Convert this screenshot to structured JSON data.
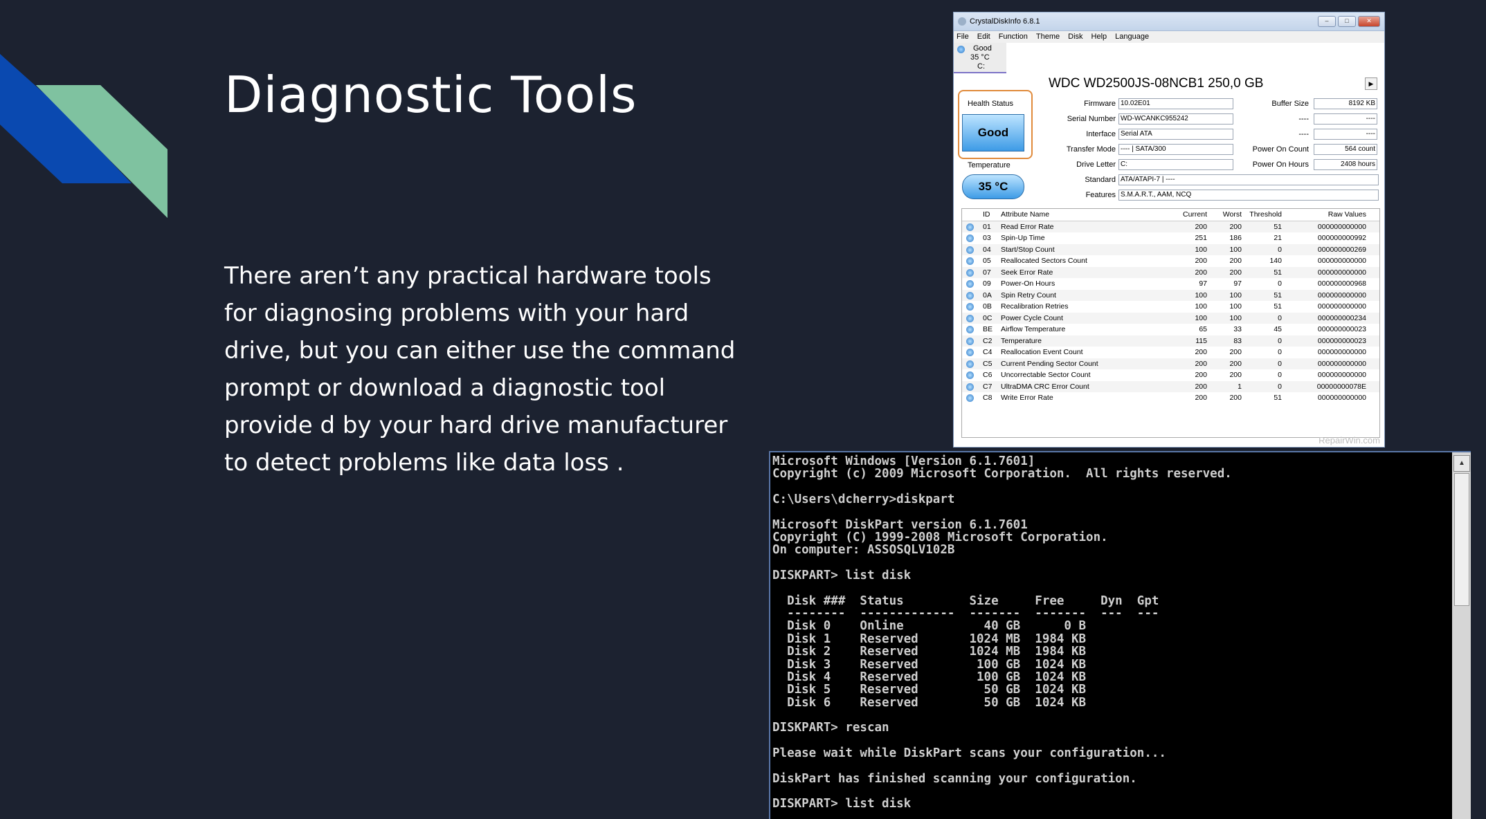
{
  "slide": {
    "title": "Diagnostic Tools",
    "body": "There aren’t any practical hardware tools for diagnosing problems with your hard drive, but you can either use the command prompt or download a diagnostic tool provide d by your hard drive manufacturer to detect problems like data loss .",
    "colors": {
      "background": "#1c2230",
      "deco_blue": "#0a49b0",
      "deco_green": "#7fc2a0"
    }
  },
  "crystaldiskinfo": {
    "window_title": "CrystalDiskInfo 6.8.1",
    "menu": [
      "File",
      "Edit",
      "Function",
      "Theme",
      "Disk",
      "Help",
      "Language"
    ],
    "disk_tab": {
      "status": "Good",
      "temp": "35 °C",
      "drive": "C:"
    },
    "model": "WDC WD2500JS-08NCB1 250,0 GB",
    "health_status_label": "Health Status",
    "health_status": "Good",
    "temperature_label": "Temperature",
    "temperature": "35 °C",
    "fields": {
      "firmware_label": "Firmware",
      "firmware": "10.02E01",
      "serial_label": "Serial Number",
      "serial": "WD-WCANKC955242",
      "interface_label": "Interface",
      "interface": "Serial ATA",
      "transfer_label": "Transfer Mode",
      "transfer": "---- | SATA/300",
      "drive_letter_label": "Drive Letter",
      "drive_letter": "C:",
      "standard_label": "Standard",
      "standard": "ATA/ATAPI-7 | ----",
      "features_label": "Features",
      "features": "S.M.A.R.T., AAM, NCQ",
      "buffer_label": "Buffer Size",
      "buffer": "8192 KB",
      "blank1_label": "----",
      "blank1": "----",
      "blank2_label": "----",
      "blank2": "----",
      "power_count_label": "Power On Count",
      "power_count": "564 count",
      "power_hours_label": "Power On Hours",
      "power_hours": "2408 hours"
    },
    "attr_headers": {
      "id": "ID",
      "name": "Attribute Name",
      "current": "Current",
      "worst": "Worst",
      "threshold": "Threshold",
      "raw": "Raw Values"
    },
    "attributes": [
      [
        "01",
        "Read Error Rate",
        "200",
        "200",
        "51",
        "000000000000"
      ],
      [
        "03",
        "Spin-Up Time",
        "251",
        "186",
        "21",
        "000000000992"
      ],
      [
        "04",
        "Start/Stop Count",
        "100",
        "100",
        "0",
        "000000000269"
      ],
      [
        "05",
        "Reallocated Sectors Count",
        "200",
        "200",
        "140",
        "000000000000"
      ],
      [
        "07",
        "Seek Error Rate",
        "200",
        "200",
        "51",
        "000000000000"
      ],
      [
        "09",
        "Power-On Hours",
        "97",
        "97",
        "0",
        "000000000968"
      ],
      [
        "0A",
        "Spin Retry Count",
        "100",
        "100",
        "51",
        "000000000000"
      ],
      [
        "0B",
        "Recalibration Retries",
        "100",
        "100",
        "51",
        "000000000000"
      ],
      [
        "0C",
        "Power Cycle Count",
        "100",
        "100",
        "0",
        "000000000234"
      ],
      [
        "BE",
        "Airflow Temperature",
        "65",
        "33",
        "45",
        "000000000023"
      ],
      [
        "C2",
        "Temperature",
        "115",
        "83",
        "0",
        "000000000023"
      ],
      [
        "C4",
        "Reallocation Event Count",
        "200",
        "200",
        "0",
        "000000000000"
      ],
      [
        "C5",
        "Current Pending Sector Count",
        "200",
        "200",
        "0",
        "000000000000"
      ],
      [
        "C6",
        "Uncorrectable Sector Count",
        "200",
        "200",
        "0",
        "000000000000"
      ],
      [
        "C7",
        "UltraDMA CRC Error Count",
        "200",
        "1",
        "0",
        "00000000078E"
      ],
      [
        "C8",
        "Write Error Rate",
        "200",
        "200",
        "51",
        "000000000000"
      ]
    ],
    "watermark": "RepairWin.com"
  },
  "cmd": {
    "lines": [
      "Microsoft Windows [Version 6.1.7601]",
      "Copyright (c) 2009 Microsoft Corporation.  All rights reserved.",
      "",
      "C:\\Users\\dcherry>diskpart",
      "",
      "Microsoft DiskPart version 6.1.7601",
      "Copyright (C) 1999-2008 Microsoft Corporation.",
      "On computer: ASSOSQLV102B",
      "",
      "DISKPART> list disk",
      "",
      "  Disk ###  Status         Size     Free     Dyn  Gpt",
      "  --------  -------------  -------  -------  ---  ---",
      "  Disk 0    Online           40 GB      0 B",
      "  Disk 1    Reserved       1024 MB  1984 KB",
      "  Disk 2    Reserved       1024 MB  1984 KB",
      "  Disk 3    Reserved        100 GB  1024 KB",
      "  Disk 4    Reserved        100 GB  1024 KB",
      "  Disk 5    Reserved         50 GB  1024 KB",
      "  Disk 6    Reserved         50 GB  1024 KB",
      "",
      "DISKPART> rescan",
      "",
      "Please wait while DiskPart scans your configuration...",
      "",
      "DiskPart has finished scanning your configuration.",
      "",
      "DISKPART> list disk"
    ]
  }
}
